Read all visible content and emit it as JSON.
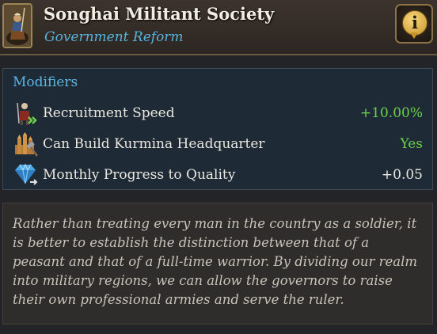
{
  "header": {
    "title": "Songhai Militant Society",
    "subtitle": "Government Reform",
    "info_glyph": "i",
    "portrait_icon": "mounted-warrior-icon",
    "info_icon": "info-speech-icon"
  },
  "modifiers": {
    "heading": "Modifiers",
    "rows": [
      {
        "label": "Recruitment Speed",
        "value": "+10.00%",
        "icon": "recruit-soldier-icon",
        "value_color": "#6bd14a"
      },
      {
        "label": "Can Build Kurmina Headquarter",
        "value": "Yes",
        "icon": "building-hammer-icon",
        "value_color": "#6bd14a"
      },
      {
        "label": "Monthly Progress to Quality",
        "value": "+0.05",
        "icon": "diamond-quality-icon",
        "value_color": "#ece8df"
      }
    ]
  },
  "description": {
    "text": "Rather than treating every man in the country as a soldier, it is better to establish the distinction between that of a peasant and that of a full-time warrior. By dividing our realm into military regions, we can allow the governors to raise their own professional armies and serve the ruler."
  },
  "colors": {
    "subtitle": "#56b3de",
    "heading": "#5cb6e4",
    "positive": "#6bd14a"
  }
}
